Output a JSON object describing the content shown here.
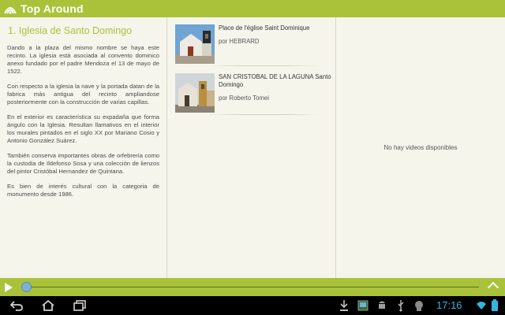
{
  "app": {
    "title": "Top Around"
  },
  "article": {
    "title": "1. Iglesia de Santo Domingo",
    "paragraphs": [
      "Dando a la plaza del mismo nombre se haya este recinto. La iglesia está asociada al convento dominico anexo fundado por el padre Mendoza el 13 de mayo de 1522.",
      "Con respecto a la iglesia la nave y la portada datan de la fabrica más antigua del recinto ampliandose posteriormente con la construcción de varias capillas.",
      "En el exterior es característica su expadaña que forma ángulo con la Iglesia. Resultan llamativos en el interior los murales pintados en el siglo XX por Mariano Cosio y Antonio González Suárez.",
      "También conserva importantes obras de orfebrería como la custodia de Ildefonso Sosa y una colección de lienzos del pintor Cristóbal Hernandez de Quintana.",
      "Es bien de interés cultural con la categoria de monumento desde 1986."
    ]
  },
  "photos": [
    {
      "title": "Place de l'église Saint Dominique",
      "author": "por HEBRARD"
    },
    {
      "title": "SAN CRISTOBAL DE LA LAGUNA Santo Domingo",
      "author": "por Roberto Tomei"
    }
  ],
  "videos": {
    "empty_message": "No hay videos disponibles"
  },
  "player": {
    "progress": 0
  },
  "status": {
    "time": "17:16"
  },
  "colors": {
    "accent": "#a9c23a",
    "clock": "#33b5e5"
  }
}
